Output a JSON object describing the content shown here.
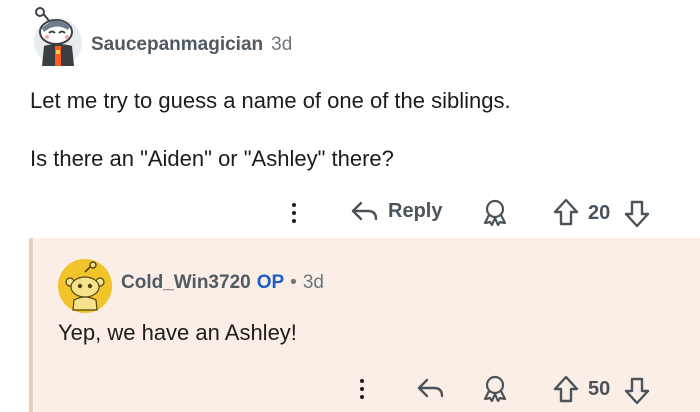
{
  "comment": {
    "username": "Saucepanmagician",
    "time": "3d",
    "body_line1": "Let me try to guess a name of one of the siblings.",
    "body_line2": "Is there an \"Aiden\" or \"Ashley\" there?",
    "reply_label": "Reply",
    "vote_count": "20",
    "icons": [
      "more-vertical-icon",
      "reply-arrow-icon",
      "award-icon",
      "upvote-icon",
      "downvote-icon"
    ]
  },
  "reply": {
    "username": "Cold_Win3720",
    "op_badge": "OP",
    "separator": "•",
    "time": "3d",
    "body": "Yep, we have an Ashley!",
    "vote_count": "50",
    "icons": [
      "more-vertical-icon",
      "reply-arrow-icon",
      "award-icon",
      "upvote-icon",
      "downvote-icon"
    ]
  },
  "colors": {
    "reply_background": "#fbeee7",
    "op_badge": "#1a5fc4",
    "avatar_reply": "#f2c42c"
  }
}
